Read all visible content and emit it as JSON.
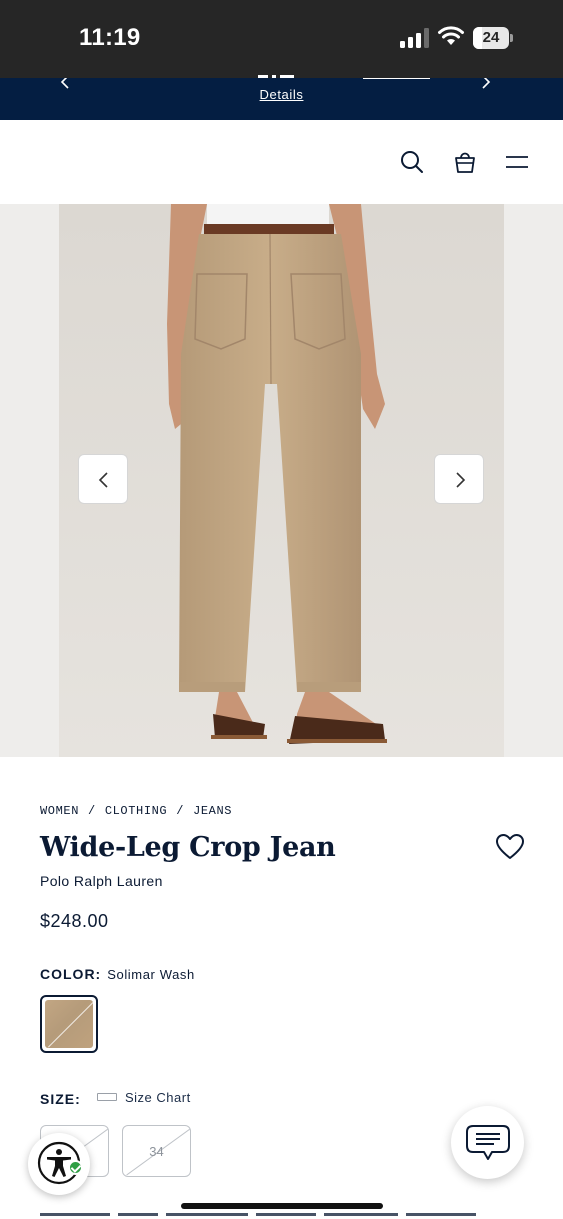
{
  "status_bar": {
    "time": "11:19",
    "battery": "24",
    "battery_level": 0.24
  },
  "promo": {
    "details_link": "Details",
    "prev_icon": "chevron-left-icon",
    "next_icon": "chevron-right-icon"
  },
  "header": {
    "icons": [
      "search-icon",
      "shopping-bag-icon",
      "hamburger-menu-icon"
    ]
  },
  "gallery": {
    "image_alt": "Wide-Leg Crop Jean back view",
    "prev_icon": "chevron-left-icon",
    "next_icon": "chevron-right-icon"
  },
  "product": {
    "breadcrumb": [
      "WOMEN",
      "CLOTHING",
      "JEANS"
    ],
    "breadcrumb_separator": "/",
    "title": "Wide-Leg Crop Jean",
    "brand": "Polo Ralph Lauren",
    "price": "$248.00",
    "wishlist_icon": "heart-icon"
  },
  "color": {
    "label": "COLOR:",
    "value": "Solimar Wash",
    "swatch_color": "#bfa27e"
  },
  "size": {
    "label": "SIZE:",
    "size_chart_label": "Size Chart",
    "options": [
      {
        "label": "",
        "available": false
      },
      {
        "label": "34",
        "available": false
      }
    ]
  },
  "widgets": {
    "accessibility_icon": "accessibility-icon",
    "chat_icon": "chat-icon"
  },
  "colors": {
    "navy": "#041e42",
    "text": "#0b1a33",
    "status_bar": "#262626"
  }
}
